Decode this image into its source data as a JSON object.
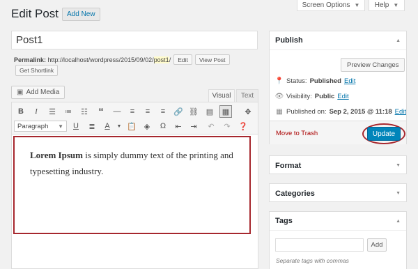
{
  "top_tabs": {
    "screen_options": "Screen Options",
    "help": "Help"
  },
  "header": {
    "title": "Edit Post",
    "add_new": "Add New"
  },
  "post": {
    "title_value": "Post1",
    "permalink_label": "Permalink:",
    "permalink_base": "http://localhost/wordpress/2015/09/02/",
    "permalink_slug": "post1",
    "permalink_trail": "/",
    "edit_label": "Edit",
    "view_post_label": "View Post",
    "get_shortlink_label": "Get Shortlink"
  },
  "editor": {
    "add_media": "Add Media",
    "tab_visual": "Visual",
    "tab_text": "Text",
    "format_select": "Paragraph",
    "content_bold": "Lorem Ipsum",
    "content_rest": " is simply dummy text of the printing and typesetting industry."
  },
  "publish": {
    "title": "Publish",
    "preview_changes": "Preview Changes",
    "status_label": "Status: ",
    "status_value": "Published",
    "visibility_label": "Visibility: ",
    "visibility_value": "Public",
    "published_label": "Published on: ",
    "published_value": "Sep 2, 2015 @ 11:18",
    "edit_link": "Edit",
    "move_to_trash": "Move to Trash",
    "update": "Update"
  },
  "boxes": {
    "format": "Format",
    "categories": "Categories",
    "tags": "Tags",
    "tags_add": "Add",
    "tags_hint": "Separate tags with commas"
  },
  "colors": {
    "accent": "#0085ba",
    "link": "#0073aa",
    "highlight_border": "#a6272e",
    "trash": "#a00"
  }
}
